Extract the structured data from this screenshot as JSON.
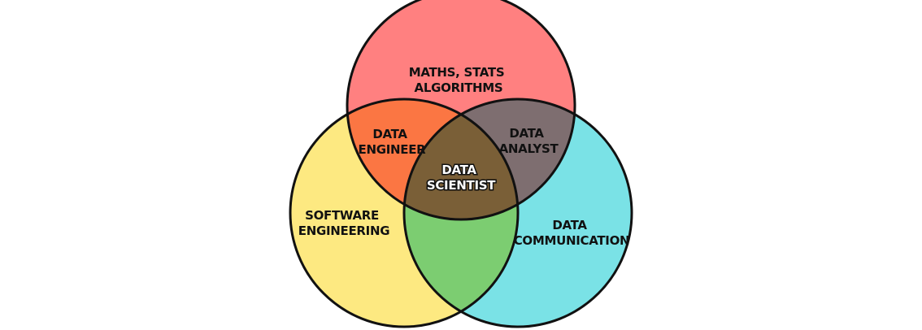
{
  "diagram": {
    "colors": {
      "maths": "#ff8080",
      "software": "#fde981",
      "communication": "#7ae2e6",
      "engineer_overlap": "#fb7643",
      "analyst_overlap": "#7e6e70",
      "software_comm_overlap": "#7ccd71",
      "center": "#7a5f37",
      "outline": "#111111"
    },
    "regions": {
      "maths_stats": {
        "line1": "MATHS, STATS",
        "line2": "ALGORITHMS"
      },
      "data_engineer": {
        "line1": "DATA",
        "line2": "ENGINEER"
      },
      "data_analyst": {
        "line1": "DATA",
        "line2": "ANALYST"
      },
      "data_scientist": {
        "line1": "DATA",
        "line2": "SCIENTIST"
      },
      "software_engineering": {
        "line1": "SOFTWARE",
        "line2": "ENGINEERING"
      },
      "data_communication": {
        "line1": "DATA",
        "line2": "COMMUNICATION"
      }
    }
  }
}
